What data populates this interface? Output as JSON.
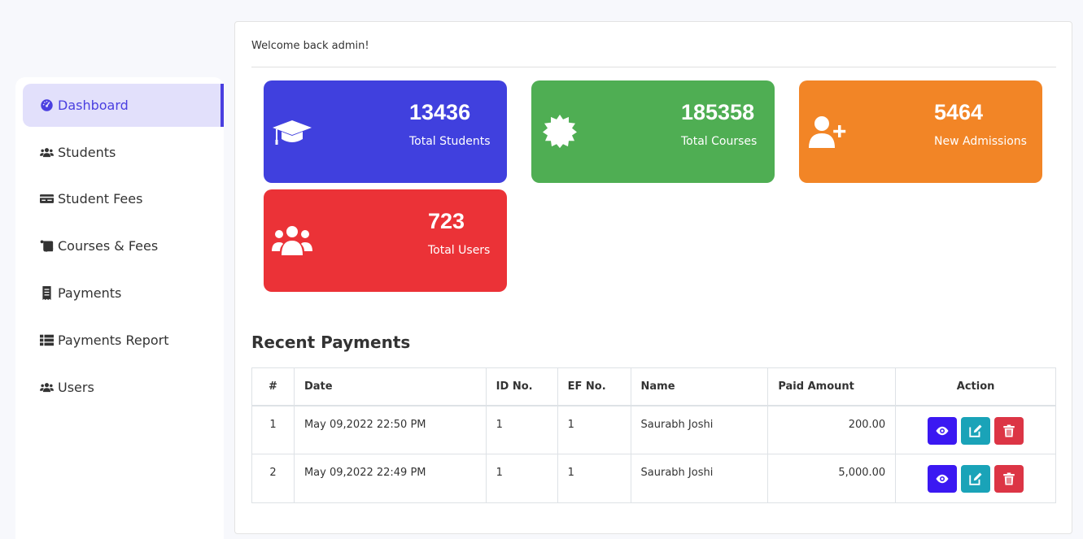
{
  "sidebar": {
    "items": [
      {
        "label": "Dashboard",
        "icon": "gauge-icon"
      },
      {
        "label": "Students",
        "icon": "users-icon"
      },
      {
        "label": "Student Fees",
        "icon": "money-bill-icon"
      },
      {
        "label": "Courses & Fees",
        "icon": "scroll-icon"
      },
      {
        "label": "Payments",
        "icon": "receipt-icon"
      },
      {
        "label": "Payments Report",
        "icon": "table-list-icon"
      },
      {
        "label": "Users",
        "icon": "users-icon"
      }
    ],
    "active": "Dashboard"
  },
  "main": {
    "welcome": "Welcome back admin!"
  },
  "cards": [
    {
      "value": "13436",
      "label": "Total Students",
      "color": "#4040de",
      "icon": "graduation-cap-icon"
    },
    {
      "value": "185358",
      "label": "Total Courses",
      "color": "#4fae53",
      "icon": "certificate-icon"
    },
    {
      "value": "5464",
      "label": "New Admissions",
      "color": "#f28526",
      "icon": "user-plus-icon"
    },
    {
      "value": "723",
      "label": "Total Users",
      "color": "#eb3237",
      "icon": "users-icon"
    }
  ],
  "payments": {
    "title": "Recent Payments",
    "columns": [
      "#",
      "Date",
      "ID No.",
      "EF No.",
      "Name",
      "Paid Amount",
      "Action"
    ],
    "rows": [
      {
        "num": "1",
        "date": "May 09,2022 22:50 PM",
        "id_no": "1",
        "ef_no": "1",
        "name": "Saurabh Joshi",
        "amount": "200.00"
      },
      {
        "num": "2",
        "date": "May 09,2022 22:49 PM",
        "id_no": "1",
        "ef_no": "1",
        "name": "Saurabh Joshi",
        "amount": "5,000.00"
      }
    ],
    "actions": [
      "view",
      "edit",
      "delete"
    ]
  },
  "colors": {
    "accent": "#4a3fe0",
    "view_button": "#3b18f2",
    "edit_button": "#1aa3b8",
    "delete_button": "#dc3545"
  }
}
